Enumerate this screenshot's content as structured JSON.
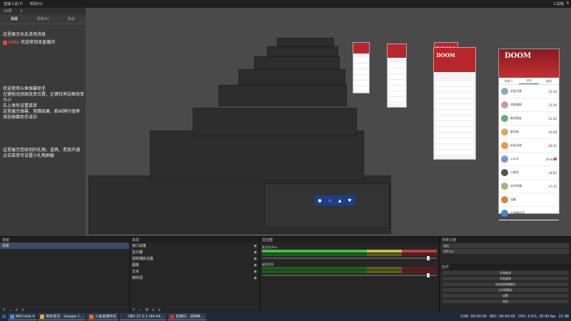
{
  "topbar": {
    "menu": [
      "直播工具(T)",
      "帮助(H)"
    ],
    "right_items": [
      "工具箱",
      "6"
    ]
  },
  "danmu": {
    "bar_items": [
      "10赞",
      "1"
    ],
    "tabs": [
      "弹幕",
      "贵族(0)",
      "粉丝"
    ],
    "lines": [
      "这里展示水友进场消息",
      "欢迎来到本直播间",
      "欢迎使用斗鱼弹幕助手",
      "左键拖动顶部改变位置，左键拉伸边框改变",
      "大小",
      "右上角有设置菜单",
      "这里展示弹幕、竞猜结果、粉丝牌升级等",
      "添加弹幕助手成功",
      "这里展示您收到的礼物、道具、贵族开通",
      "点击菜单可设置小礼物屏蔽"
    ],
    "badge_name": "Hello"
  },
  "phone": {
    "doom": "DOOM",
    "tabs": [
      "联系人",
      "消息",
      "群组"
    ],
    "rows": [
      "好友列表",
      "消息通知",
      "新的朋友",
      "群消息",
      "好友动态",
      "公众号",
      "小程序",
      "文件传输",
      "设备",
      "大家都在用"
    ],
    "times": [
      "21:34",
      "21:29",
      "21:20",
      "20:58",
      "20:31",
      "19:44",
      "18:02",
      "17:15"
    ]
  },
  "overlay": {
    "icons": [
      "●",
      "☆",
      "▲",
      "♥"
    ]
  },
  "dock": {
    "scenes": {
      "title": "场景",
      "items": [
        "场景"
      ]
    },
    "sources": {
      "title": "来源",
      "items": [
        {
          "name": "窗口采集"
        },
        {
          "name": "显示器"
        },
        {
          "name": "视频捕获设备"
        },
        {
          "name": "图像"
        },
        {
          "name": "文本"
        },
        {
          "name": "媒体源"
        }
      ]
    },
    "mixer": {
      "title": "混音器",
      "channels": [
        "麦克风/Aux",
        "桌面音频"
      ]
    },
    "transitions": {
      "title": "场景过渡",
      "selected": "淡出",
      "duration": "300 ms"
    },
    "controls": {
      "title": "控件",
      "buttons": [
        "开始推流",
        "开始录制",
        "启动虚拟摄像机",
        "工作室模式",
        "设置",
        "退出"
      ]
    }
  },
  "status": {
    "items": [
      "LIVE: 00:00:00",
      "REC: 00:00:00",
      "CPU: 3.5%, 30.00 fps"
    ]
  },
  "taskbar": {
    "apps": [
      "NECrotal 4",
      "新标签页 - Google C...",
      "斗鱼直播伴侣",
      "OBS 27.0.1 (64-bit...",
      "直播间，请稍等..."
    ],
    "time": "21:38"
  }
}
